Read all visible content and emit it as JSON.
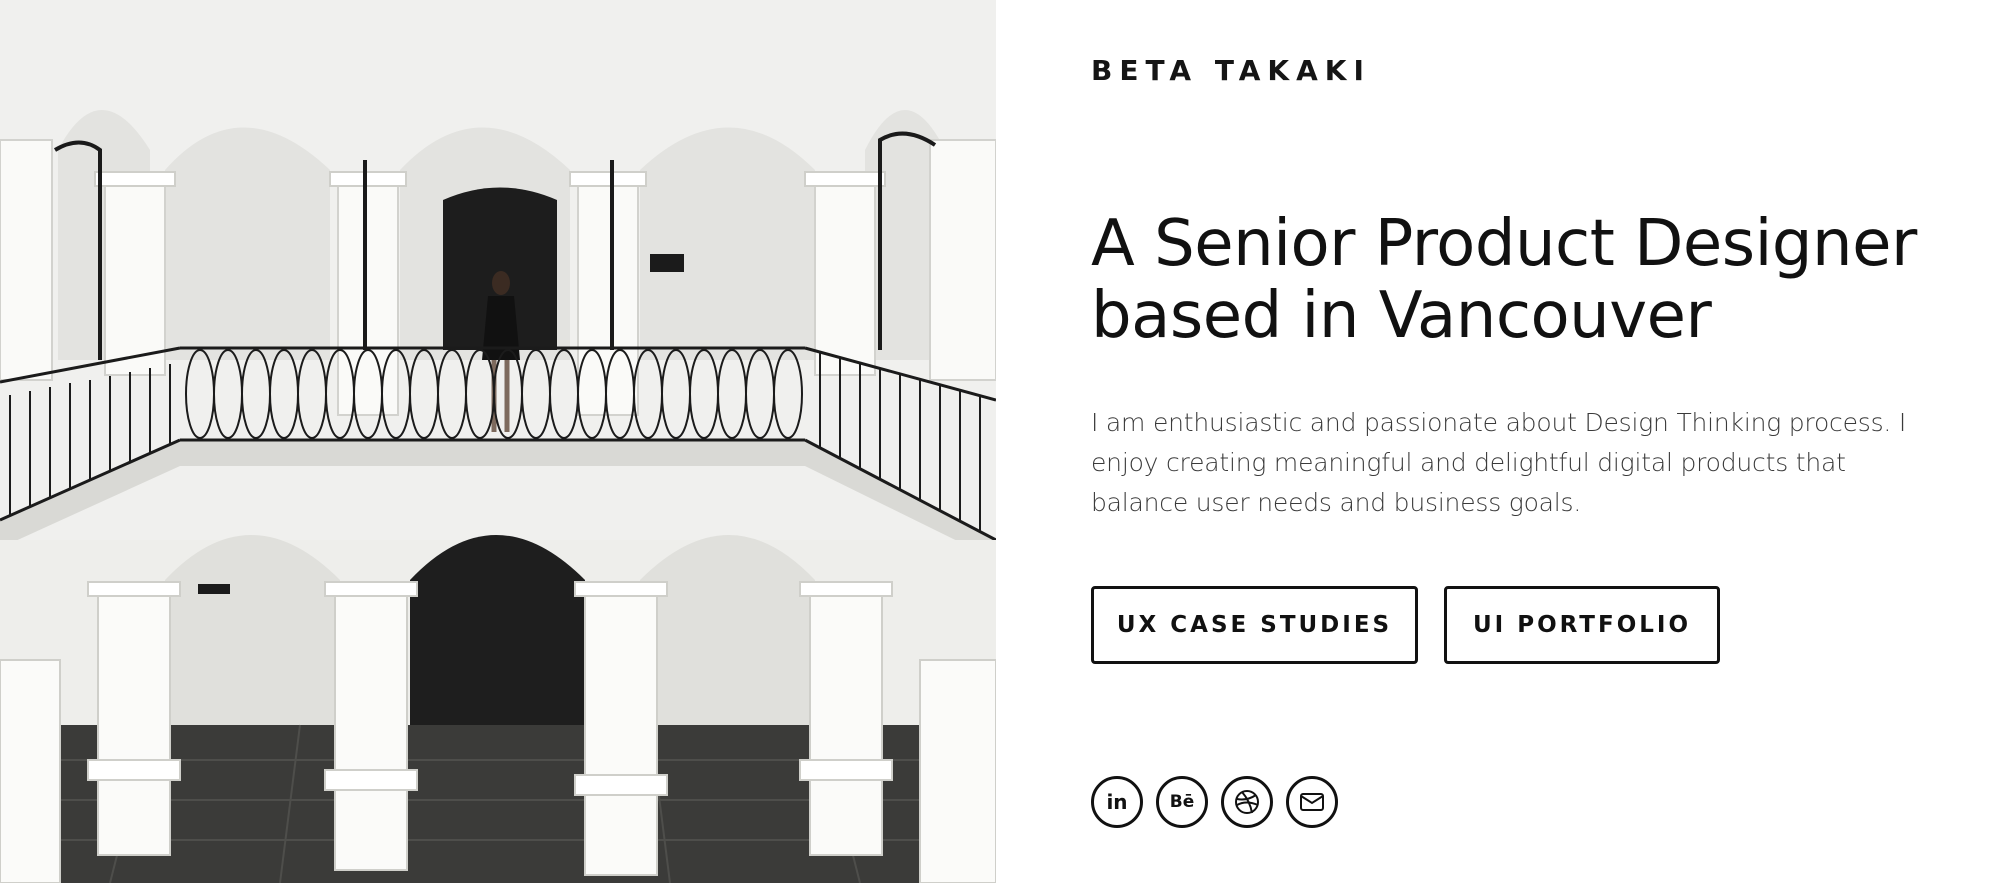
{
  "hero": {
    "image_description_icon": "courtyard-photo",
    "brand": "BETA TAKAKI",
    "headline_line1": "A Senior Product Designer",
    "headline_line2": "based in Vancouver",
    "intro": "I  am enthusiastic and passionate about Design Thinking process. I enjoy creating meaningful and delightful digital products that balance user needs and  business goals.",
    "buttons": {
      "ux": "UX CASE STUDIES",
      "ui": "UI PORTFOLIO"
    }
  },
  "socials": [
    {
      "name": "linkedin",
      "icon": "linkedin-icon",
      "glyph": "in"
    },
    {
      "name": "behance",
      "icon": "behance-icon",
      "glyph": "Bē"
    },
    {
      "name": "dribbble",
      "icon": "dribbble-icon",
      "glyph": ""
    },
    {
      "name": "email",
      "icon": "mail-icon",
      "glyph": ""
    }
  ],
  "colors": {
    "text": "#111111",
    "body_text": "#3a3a3a",
    "background": "#ffffff",
    "photo_wall": "#f1f1ef",
    "photo_shadow": "#2a2a2a"
  }
}
